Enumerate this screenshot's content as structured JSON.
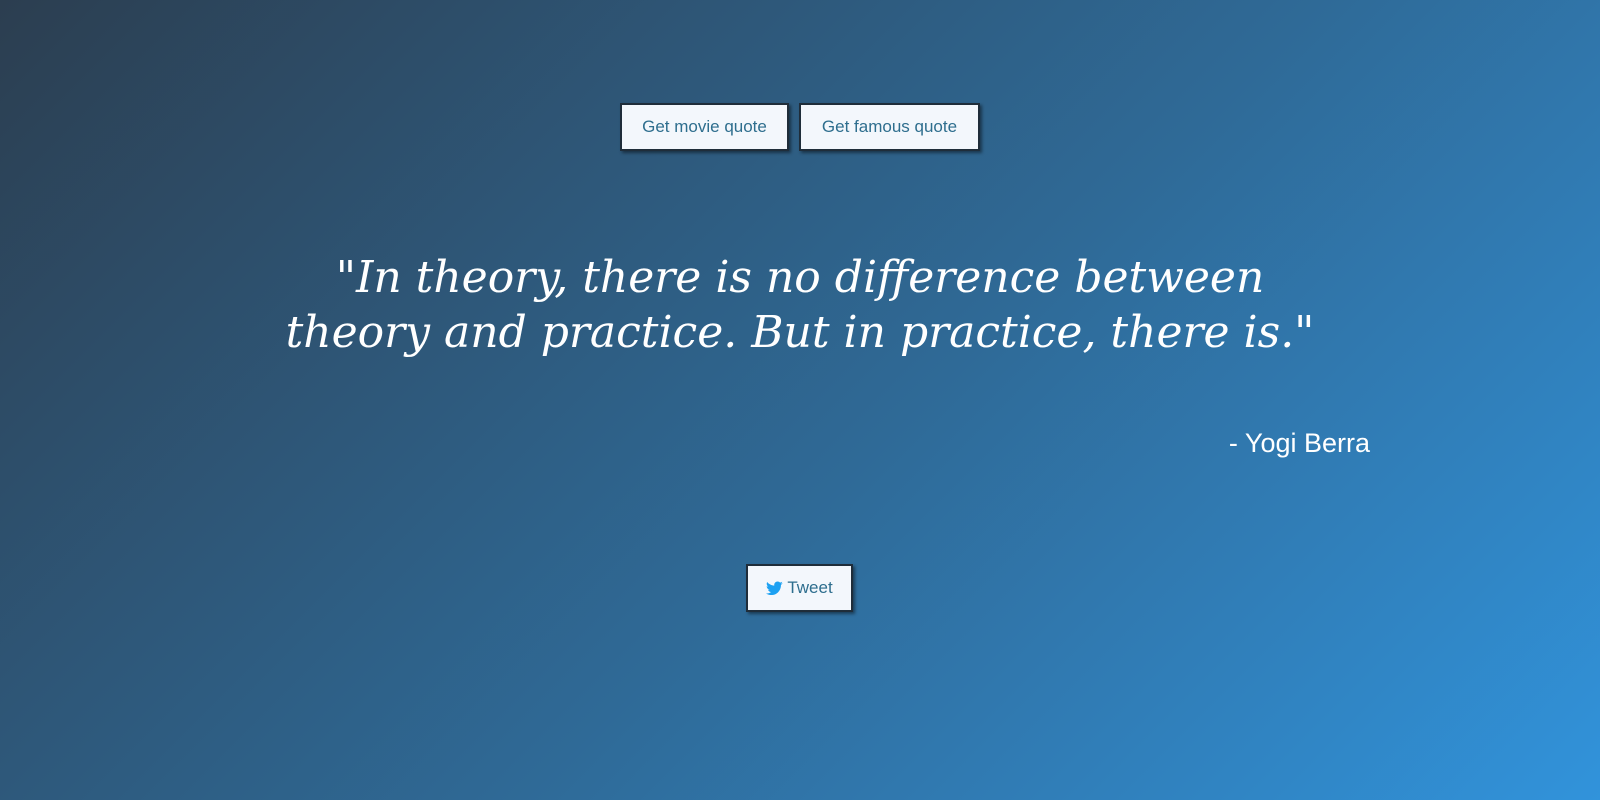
{
  "buttons": {
    "movie_quote_label": "Get movie quote",
    "famous_quote_label": "Get famous quote",
    "tweet_label": "Tweet"
  },
  "quote": {
    "text": "\"In theory, there is no difference between theory and practice. But in practice, there is.\"",
    "author": "- Yogi Berra"
  },
  "icons": {
    "tweet_icon": "twitter-bird-icon"
  },
  "colors": {
    "background_start": "#2c3e50",
    "background_end": "#3193db",
    "button_bg": "#f3f7fc",
    "button_text": "#2e6e8e",
    "twitter_blue": "#1da1f2"
  }
}
